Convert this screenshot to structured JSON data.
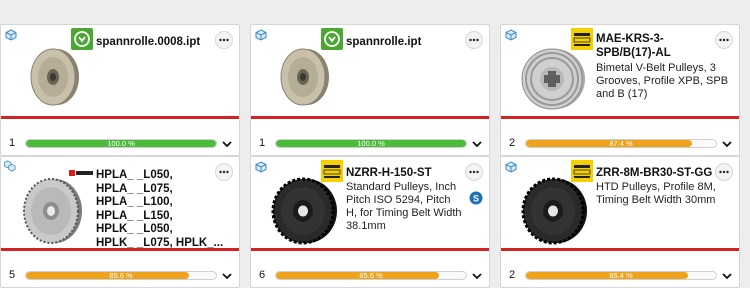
{
  "cards": [
    {
      "title": "spannrolle.0008.ipt",
      "description": "",
      "count": "1",
      "percent_label": "100.0 %",
      "percent": 1.0,
      "bar_color": "#4cbb3c",
      "badge": "cad-logo-green",
      "thumb": "spannrolle"
    },
    {
      "title": "spannrolle.ipt",
      "description": "",
      "count": "1",
      "percent_label": "100.0 %",
      "percent": 1.0,
      "bar_color": "#4cbb3c",
      "badge": "cad-logo-green",
      "thumb": "spannrolle"
    },
    {
      "title": "MAE-KRS-3-\nSPB/B(17)-AL",
      "description": "Bimetal V-Belt Pulleys, 3 Grooves, Profile XPB, SPB and B (17)",
      "count": "2",
      "percent_label": "87.4 %",
      "percent": 0.874,
      "bar_color": "#efa21c",
      "badge": "maedler-logo",
      "thumb": "vbelt"
    },
    {
      "title": "HPLA_ _L050,\nHPLA_ _L075,\nHPLA_ _L100,\nHPLA_ _L150,\nHPLK_ _L050,\nHPLK_ _L075, HPLK_...",
      "description": "",
      "count": "5",
      "percent_label": "85.6 %",
      "percent": 0.856,
      "bar_color": "#efa21c",
      "badge": "brand-logo-small",
      "thumb": "timing-grey"
    },
    {
      "title": "NZRR-H-150-ST",
      "description": "Standard Pulleys, Inch Pitch ISO 5294, Pitch H, for Timing Belt Width 38.1mm",
      "count": "6",
      "percent_label": "85.6 %",
      "percent": 0.856,
      "bar_color": "#efa21c",
      "badge": "maedler-logo",
      "thumb": "timing-black"
    },
    {
      "title": "ZRR-8M-BR30-ST-GG",
      "description": "HTD Pulleys, Profile 8M, Timing Belt Width 30mm",
      "count": "2",
      "percent_label": "85.4 %",
      "percent": 0.854,
      "bar_color": "#efa21c",
      "badge": "maedler-logo",
      "thumb": "timing-black"
    }
  ],
  "icons": {
    "more": "more-options-icon",
    "expand": "chevron-down-icon",
    "cube": "3d-cube-icon",
    "s_badge": "s-circle-icon"
  },
  "colors": {
    "red_line": "#d32222",
    "green": "#4cbb3c",
    "orange": "#efa21c",
    "maedler_yellow": "#f4d000"
  }
}
